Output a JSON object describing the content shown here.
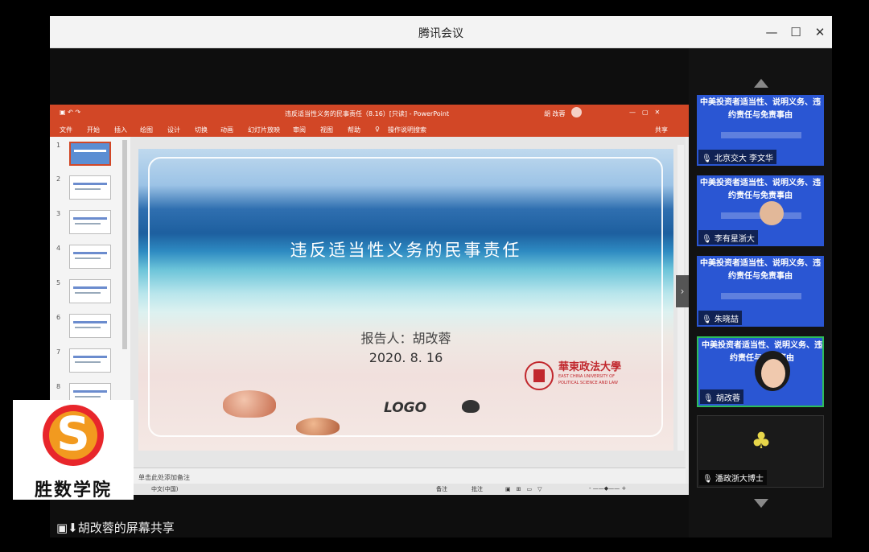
{
  "window": {
    "title": "腾讯会议"
  },
  "ppt": {
    "doc_title": "违反适当性义务的民事责任（8.16）[只读] - PowerPoint",
    "user": "胡 改蓉",
    "share": "共享",
    "tabs": [
      "文件",
      "开始",
      "插入",
      "绘图",
      "设计",
      "切换",
      "动画",
      "幻灯片放映",
      "审阅",
      "视图",
      "帮助",
      "操作说明搜索"
    ],
    "slide_numbers": [
      "1",
      "2",
      "3",
      "4",
      "5",
      "6",
      "7",
      "8"
    ],
    "notes_placeholder": "单击此处添加备注",
    "status_lang": "中文(中国)",
    "status_notes": "备注",
    "status_comments": "批注"
  },
  "slide": {
    "title": "违反适当性义务的民事责任",
    "reporter": "报告人：胡改蓉",
    "date": "2020. 8. 16",
    "logo": "LOGO",
    "university_cn": "華東政法大學",
    "university_en1": "EAST CHINA UNIVERSITY OF",
    "university_en2": "POLITICAL SCIENCE AND LAW"
  },
  "screen_share": {
    "label": "胡改蓉的屏幕共享"
  },
  "participants": [
    {
      "label": "北京交大 李文华",
      "slide_text": "中美投资者适当性、说明义务、违约责任与免责事由"
    },
    {
      "label": "李有星浙大",
      "slide_text": "中美投资者适当性、说明义务、违约责任与免责事由"
    },
    {
      "label": "朱晓喆",
      "slide_text": "中美投资者适当性、说明义务、违约责任与免责事由"
    },
    {
      "label": "胡改蓉",
      "slide_text": "中美投资者适当性、说明义务、违约责任与免责事由"
    },
    {
      "label": "潘政浙大博士"
    }
  ],
  "watermark": {
    "text": "胜数学院",
    "letter": "S"
  }
}
